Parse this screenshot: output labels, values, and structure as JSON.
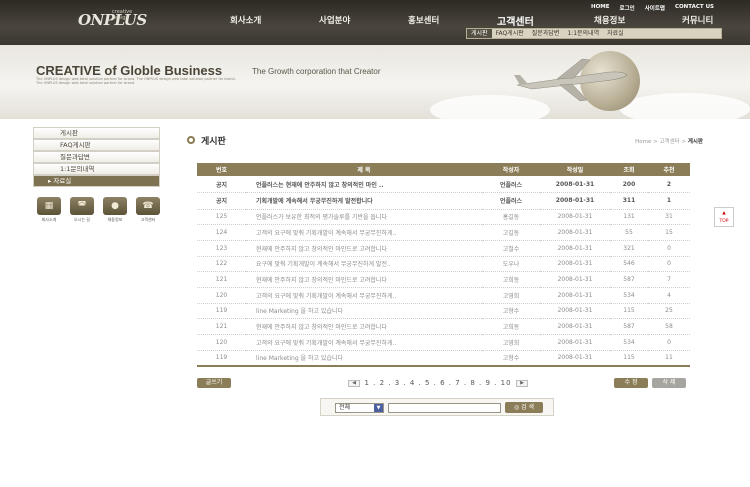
{
  "header": {
    "logo_main": "ONPLUS",
    "logo_sub": "creative design",
    "utility": [
      "HOME",
      "로그인",
      "사이트맵",
      "CONTACT US"
    ],
    "gnb": [
      "회사소개",
      "사업분야",
      "홍보센터",
      "고객센터",
      "채용정보",
      "커뮤니티"
    ],
    "gnb_active": "고객센터",
    "subnav": [
      "게시판",
      "FAQ게시판",
      "질문과답변",
      "1:1문의내역",
      "자료실"
    ]
  },
  "visual": {
    "title_prefix": "CREATIVE",
    "title_rest": " of Globle Business",
    "subtitle": "The Growth corporation that Creator",
    "fine_text": "The ONPLUS design web total solution partner for brand. The ONPLUS design web total solution partner for brand. The ONPLUS design web total solution partner for brand."
  },
  "lnb": {
    "items": [
      "게시판",
      "FAQ게시판",
      "질문과답변",
      "1:1문의내역",
      "자료실"
    ],
    "selected_index": 4
  },
  "quick": [
    {
      "label": "회사소개",
      "icon": "building-icon"
    },
    {
      "label": "오시는 길",
      "icon": "car-icon"
    },
    {
      "label": "채용정보",
      "icon": "people-icon"
    },
    {
      "label": "고객센터",
      "icon": "headset-icon"
    }
  ],
  "page": {
    "title": "게시판",
    "breadcrumb": [
      "Home",
      "고객센터"
    ],
    "breadcrumb_current": "게시판"
  },
  "board": {
    "columns": [
      "번호",
      "제 목",
      "작성자",
      "작성일",
      "조회",
      "추천"
    ],
    "notices": [
      {
        "no": "공지",
        "title": "언플러스는 현재에 안주하지 않고 창의적인 마인 ..",
        "author": "언플러스",
        "date": "2008-01-31",
        "views": "200",
        "rec": "2"
      },
      {
        "no": "공지",
        "title": "기획개발에 계속해서 무궁무진하게 발전합니다",
        "author": "언플러스",
        "date": "2008-01-31",
        "views": "311",
        "rec": "1"
      }
    ],
    "rows": [
      {
        "no": "125",
        "title": "언플러스가 보유한 최적의 평가솔루를 기반을 둡니다",
        "author": "홍길동",
        "date": "2008-01-31",
        "views": "131",
        "rec": "31"
      },
      {
        "no": "124",
        "title": "고객의 요구에 맞춰 기획개발이 계속해서 무궁무진하게..",
        "author": "고길동",
        "date": "2008-01-31",
        "views": "55",
        "rec": "15"
      },
      {
        "no": "123",
        "title": "현재에 안주하지 않고 창의적인 마인드로 고려합니다",
        "author": "고철수",
        "date": "2008-01-31",
        "views": "321",
        "rec": "0"
      },
      {
        "no": "122",
        "title": "요구에 맞춰 기획개발이 계속해서 무궁무진하게 발전..",
        "author": "도우나",
        "date": "2008-01-31",
        "views": "546",
        "rec": "0"
      },
      {
        "no": "121",
        "title": "현재에 안주하지 않고 창의적인 마인드로 고려합니다",
        "author": "고희동",
        "date": "2008-01-31",
        "views": "587",
        "rec": "7"
      },
      {
        "no": "120",
        "title": "고객의 요구에 맞춰 기획개발이 계속해서 무궁무진하게..",
        "author": "고영희",
        "date": "2008-01-31",
        "views": "534",
        "rec": "4"
      },
      {
        "no": "119",
        "title": "line Marketing 을 하고 있습니다",
        "author": "고형수",
        "date": "2008-01-31",
        "views": "115",
        "rec": "25"
      },
      {
        "no": "121",
        "title": "현재에 안주하지 않고 창의적인 마인드로 고려합니다",
        "author": "고희동",
        "date": "2008-01-31",
        "views": "587",
        "rec": "58"
      },
      {
        "no": "120",
        "title": "고객의 요구에 맞춰 기획개발이 계속해서 무궁무진하게..",
        "author": "고영희",
        "date": "2008-01-31",
        "views": "534",
        "rec": "0"
      },
      {
        "no": "119",
        "title": "line Marketing 을 하고 있습니다",
        "author": "고형수",
        "date": "2008-01-31",
        "views": "115",
        "rec": "11"
      }
    ]
  },
  "actions": {
    "list_label": "글쓰기",
    "edit_label": "수 정",
    "delete_label": "삭 제",
    "pages": "1 . 2 . 3 . 4 . 5 . 6 . 7 . 8 . 9 . 10",
    "prev": "◀",
    "next": "▶"
  },
  "search": {
    "select_value": "전체",
    "button_label": "검 색"
  },
  "top_button": "TOP",
  "colors": {
    "accent": "#8b7d57",
    "header_bg": "#3a372f"
  }
}
